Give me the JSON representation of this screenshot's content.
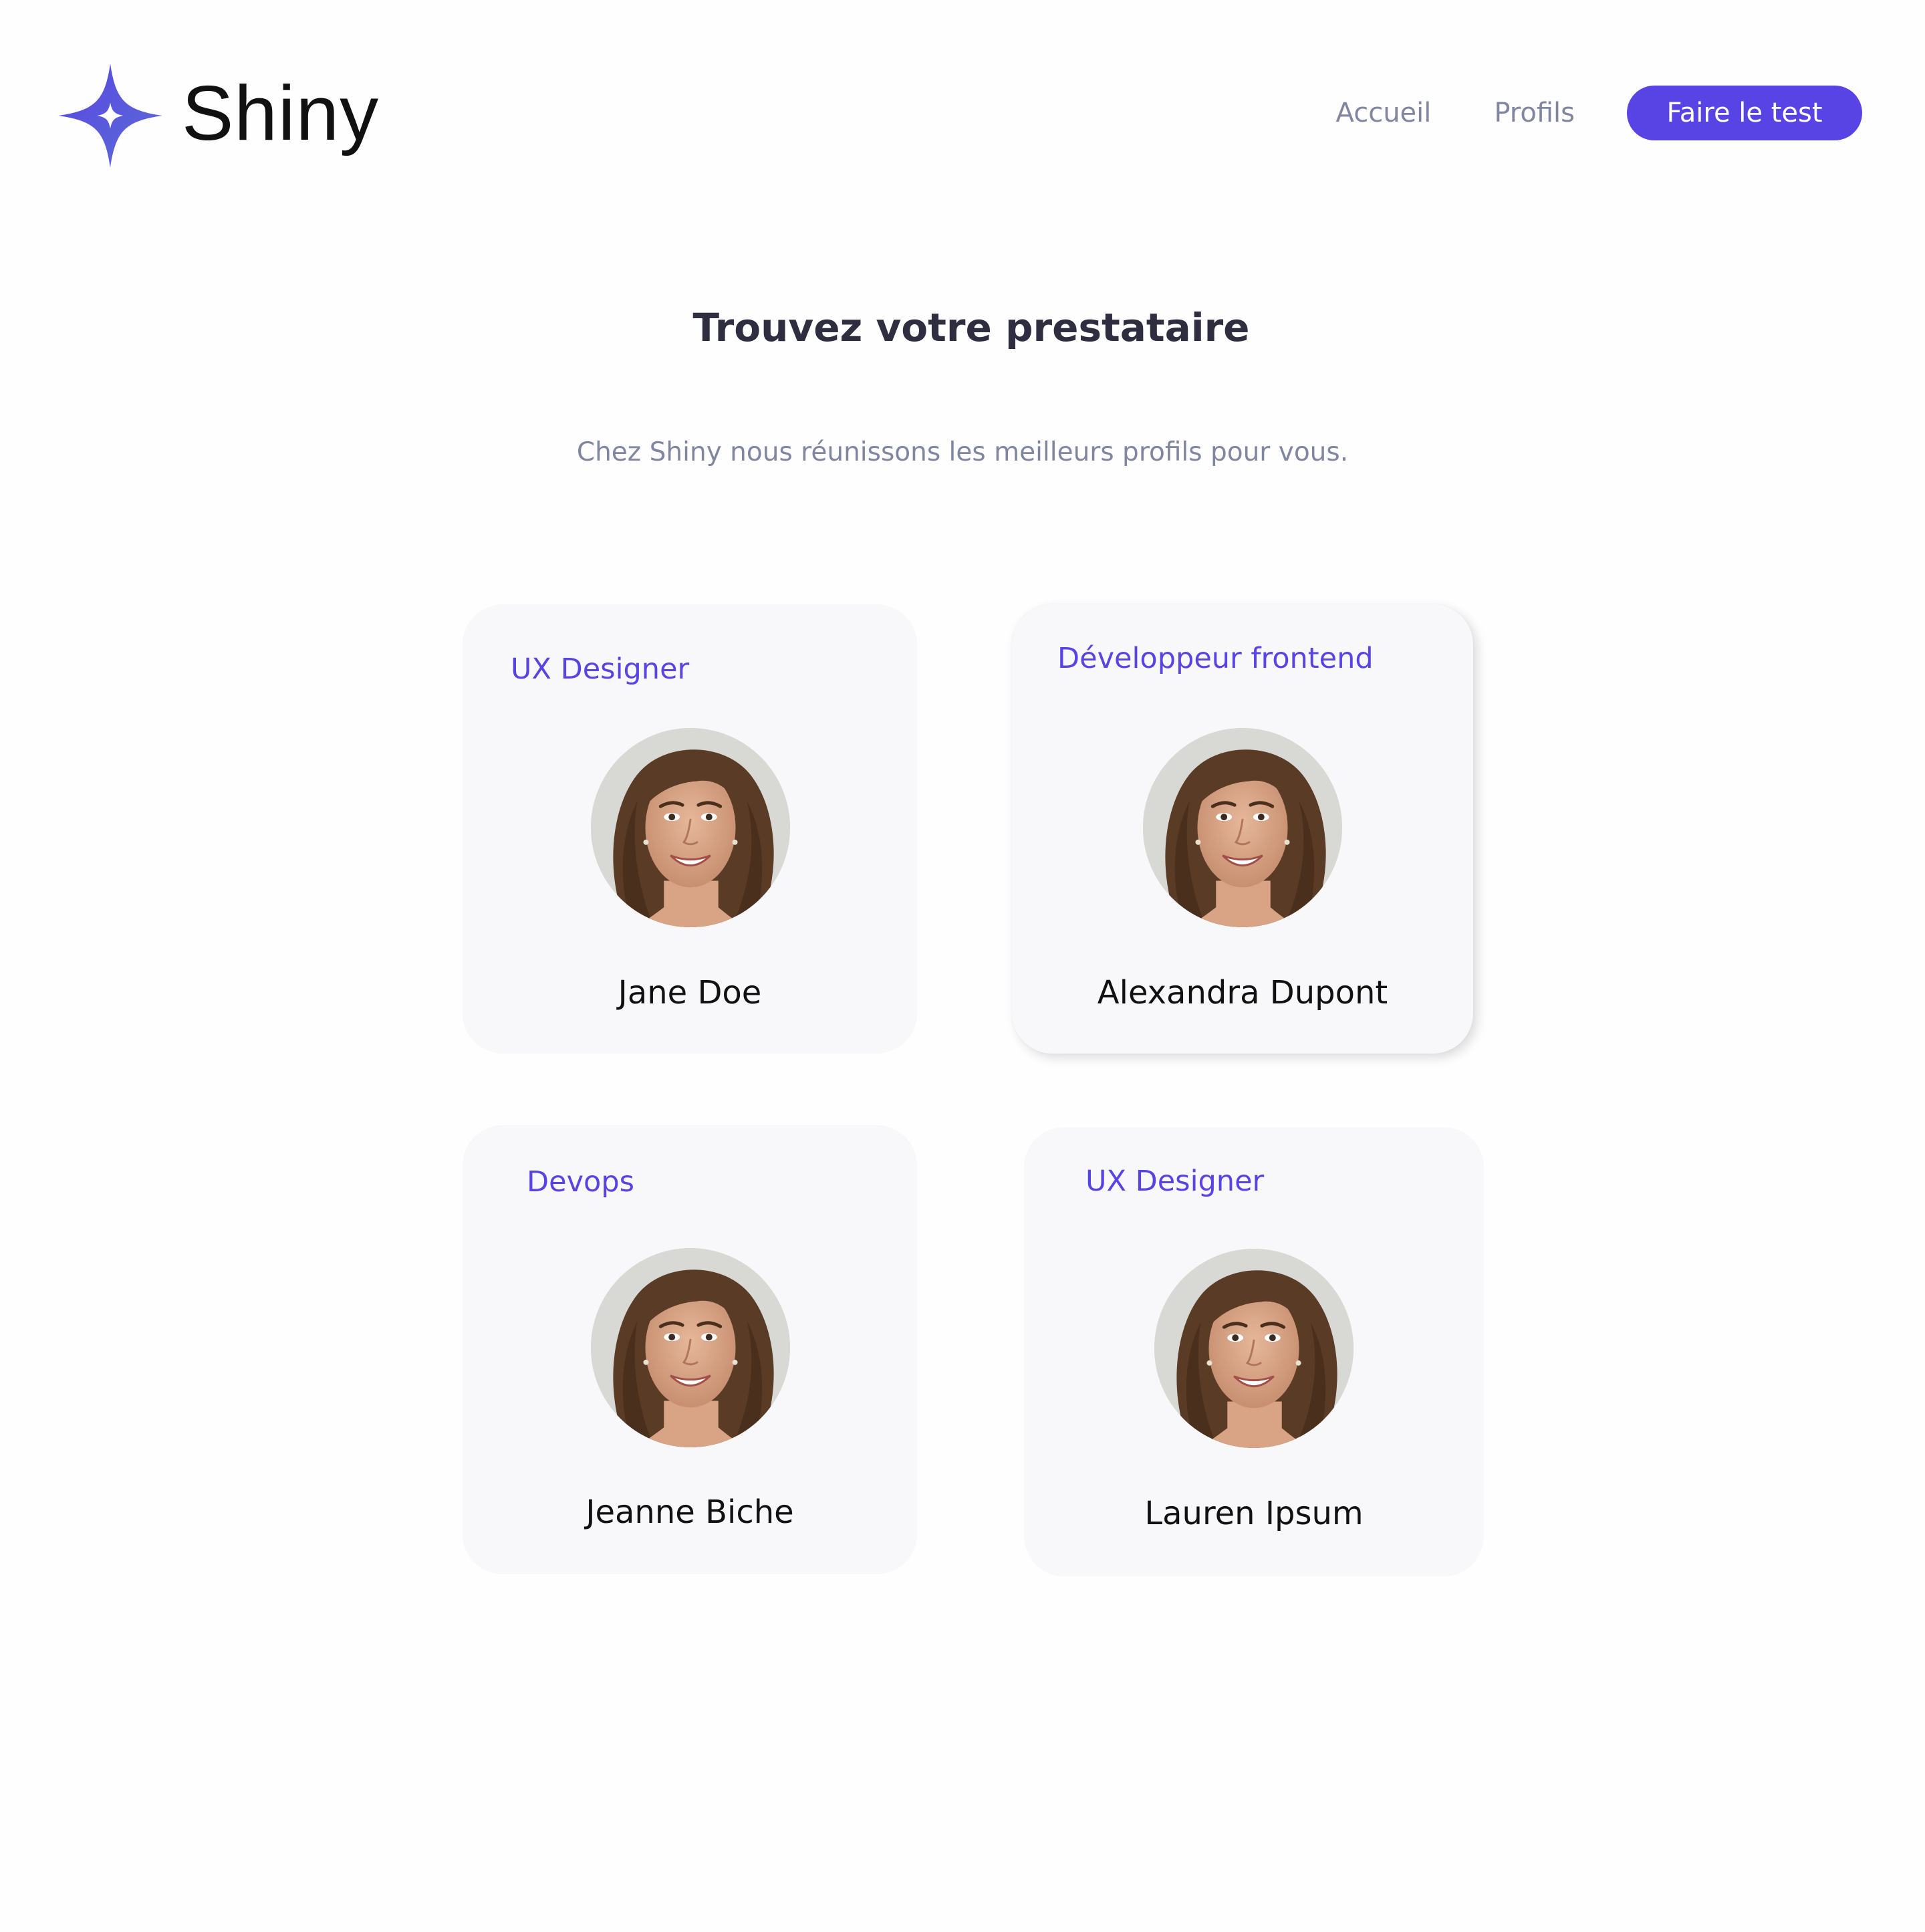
{
  "brand": {
    "name": "Shiny",
    "colors": {
      "accent": "#5843e4",
      "title": "#2f2e41",
      "muted": "#8186a0",
      "card_background": "#f8f8fa"
    }
  },
  "nav": {
    "links": [
      "Accueil",
      "Profils"
    ],
    "cta": "Faire le test"
  },
  "hero": {
    "title": "Trouvez votre prestataire",
    "subtitle": "Chez Shiny nous réunissons les meilleurs profils pour vous."
  },
  "profiles": [
    {
      "job": "UX Designer",
      "name": "Jane Doe",
      "picture": "profile-photo-woman"
    },
    {
      "job": "Développeur frontend",
      "name": "Alexandra Dupont",
      "picture": "profile-photo-woman"
    },
    {
      "job": "Devops",
      "name": "Jeanne Biche",
      "picture": "profile-photo-woman"
    },
    {
      "job": "UX Designer",
      "name": "Lauren Ipsum",
      "picture": "profile-photo-woman"
    }
  ]
}
